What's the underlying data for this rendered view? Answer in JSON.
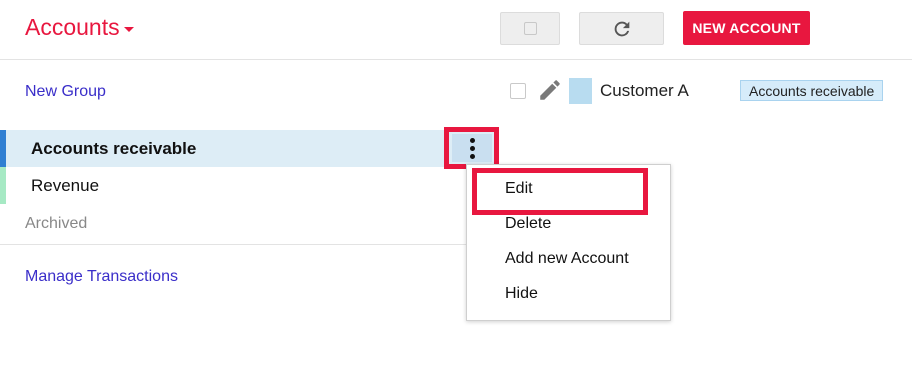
{
  "header": {
    "title": "Accounts",
    "new_account_label": "NEW ACCOUNT",
    "icons": [
      "checkbox-icon",
      "refresh-icon",
      "caret-down-icon"
    ]
  },
  "sidebar": {
    "new_group": "New Group",
    "groups": [
      {
        "label": "Accounts receivable",
        "selected": true,
        "color": "#2f7fd2"
      },
      {
        "label": "Revenue",
        "selected": false,
        "color": "#a6e9c4"
      }
    ],
    "archived": "Archived",
    "manage_transactions": "Manage Transactions"
  },
  "account_row": {
    "name": "Customer A",
    "group_tag": "Accounts receivable",
    "swatch_color": "#b8dcf0"
  },
  "context_menu": {
    "items": [
      "Edit",
      "Delete",
      "Add new Account",
      "Hide"
    ]
  },
  "colors": {
    "accent": "#e8173f",
    "link": "#3a2ec9",
    "selected_row": "#ddedf6"
  }
}
